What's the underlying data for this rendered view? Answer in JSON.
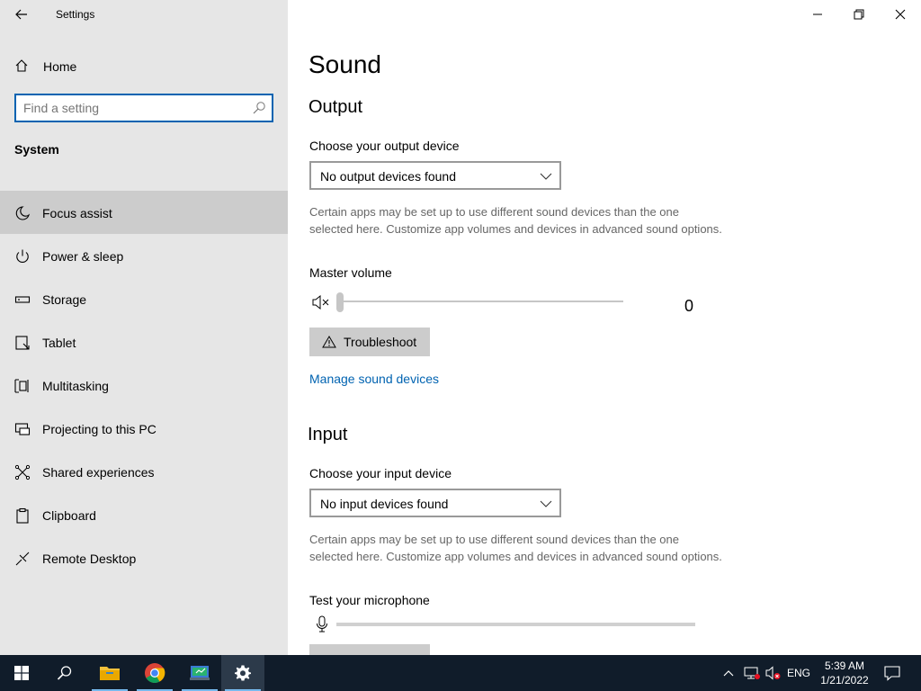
{
  "window": {
    "title": "Settings"
  },
  "sidebar": {
    "home_label": "Home",
    "search_placeholder": "Find a setting",
    "section_label": "System",
    "items": [
      {
        "label": "Focus assist",
        "icon": "moon-icon",
        "selected": true
      },
      {
        "label": "Power & sleep",
        "icon": "power-icon",
        "selected": false
      },
      {
        "label": "Storage",
        "icon": "storage-icon",
        "selected": false
      },
      {
        "label": "Tablet",
        "icon": "tablet-icon",
        "selected": false
      },
      {
        "label": "Multitasking",
        "icon": "multitasking-icon",
        "selected": false
      },
      {
        "label": "Projecting to this PC",
        "icon": "projecting-icon",
        "selected": false
      },
      {
        "label": "Shared experiences",
        "icon": "shared-icon",
        "selected": false
      },
      {
        "label": "Clipboard",
        "icon": "clipboard-icon",
        "selected": false
      },
      {
        "label": "Remote Desktop",
        "icon": "remote-desktop-icon",
        "selected": false
      }
    ]
  },
  "main": {
    "title": "Sound",
    "output": {
      "heading": "Output",
      "device_label": "Choose your output device",
      "device_value": "No output devices found",
      "description": "Certain apps may be set up to use different sound devices than the one selected here. Customize app volumes and devices in advanced sound options.",
      "volume_label": "Master volume",
      "volume_value": "0",
      "volume_level": 0,
      "troubleshoot_label": "Troubleshoot",
      "manage_link": "Manage sound devices"
    },
    "input": {
      "heading": "Input",
      "device_label": "Choose your input device",
      "device_value": "No input devices found",
      "description": "Certain apps may be set up to use different sound devices than the one selected here. Customize app volumes and devices in advanced sound options.",
      "mic_label": "Test your microphone",
      "mic_level": 0
    }
  },
  "taskbar": {
    "language": "ENG",
    "time": "5:39 AM",
    "date": "1/21/2022"
  },
  "colors": {
    "accent": "#0063b1",
    "sidebar_bg": "#e6e6e6",
    "selected_bg": "#cccccc",
    "taskbar_bg": "#101c2a"
  }
}
